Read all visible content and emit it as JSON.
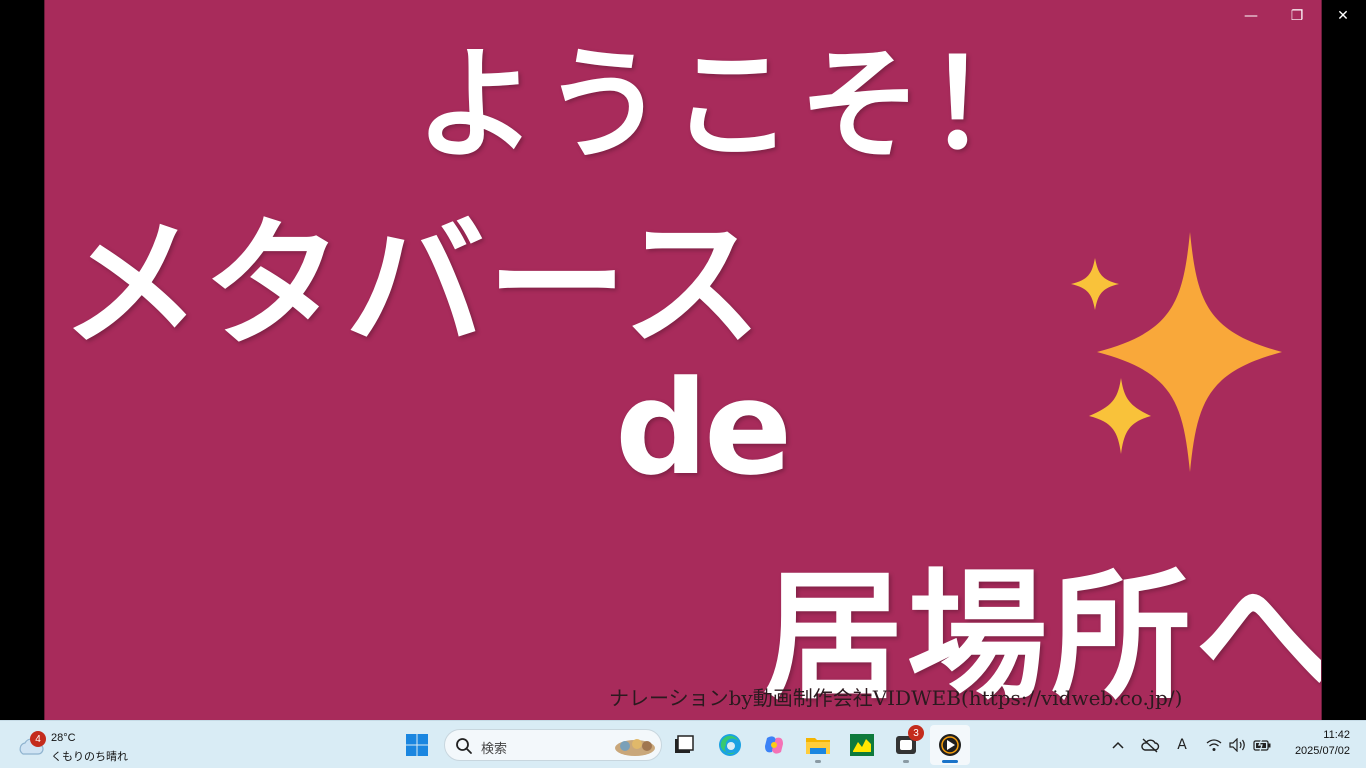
{
  "video": {
    "line1": "ようこそ！",
    "line2": "メタバース",
    "line3": "de",
    "line4": "居場所へ",
    "narration": "ナレーションby動画制作会社VIDWEB(https://vidweb.co.jp/)",
    "background_color": "#a82b5b",
    "sparkle_color": "#f9b23a"
  },
  "window": {
    "minimize_glyph": "—",
    "restore_glyph": "❐",
    "close_glyph": "✕"
  },
  "taskbar": {
    "weather": {
      "badge": "4",
      "temperature": "28°C",
      "description": "くもりのち晴れ"
    },
    "search": {
      "placeholder": "検索"
    },
    "apps": [
      {
        "name": "task-view",
        "icon": "task-view-icon"
      },
      {
        "name": "edge",
        "icon": "edge-icon"
      },
      {
        "name": "copilot",
        "icon": "copilot-icon"
      },
      {
        "name": "file-explorer",
        "icon": "folder-icon"
      },
      {
        "name": "stock-app",
        "icon": "stock-icon"
      },
      {
        "name": "notification-app",
        "icon": "chat-icon",
        "badge": "3"
      },
      {
        "name": "media-player",
        "icon": "play-icon",
        "active": true
      }
    ],
    "clock": {
      "time": "11:42",
      "date": "2025/07/02"
    },
    "tray": {
      "ime_glyph": "A"
    }
  }
}
